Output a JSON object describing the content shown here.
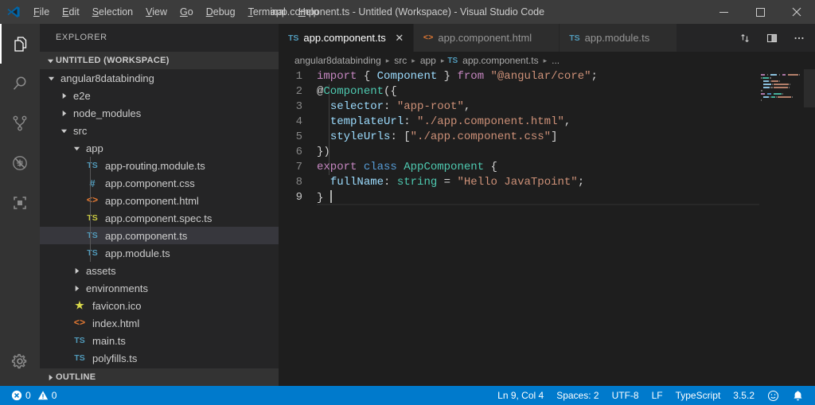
{
  "titlebar": {
    "window_title": "app.component.ts - Untitled (Workspace) - Visual Studio Code",
    "logo_icon": "vscode-logo-icon",
    "menus": [
      {
        "label": "File",
        "icon": "menu-file"
      },
      {
        "label": "Edit",
        "icon": "menu-edit"
      },
      {
        "label": "Selection",
        "icon": "menu-selection"
      },
      {
        "label": "View",
        "icon": "menu-view"
      },
      {
        "label": "Go",
        "icon": "menu-go"
      },
      {
        "label": "Debug",
        "icon": "menu-debug"
      },
      {
        "label": "Terminal",
        "icon": "menu-terminal"
      },
      {
        "label": "Help",
        "icon": "menu-help"
      }
    ],
    "controls": {
      "minimize": "minimize-icon",
      "maximize": "maximize-icon",
      "close": "close-icon"
    }
  },
  "activitybar": {
    "items": [
      {
        "name": "explorer",
        "icon": "files-icon",
        "active": true
      },
      {
        "name": "search",
        "icon": "search-icon",
        "active": false
      },
      {
        "name": "source-control",
        "icon": "source-control-icon",
        "active": false
      },
      {
        "name": "debug",
        "icon": "debug-icon",
        "active": false
      },
      {
        "name": "extensions",
        "icon": "extensions-icon",
        "active": false
      }
    ],
    "bottom": [
      {
        "name": "manage",
        "icon": "gear-icon"
      }
    ]
  },
  "sidebar": {
    "title": "EXPLORER",
    "workspace_header": "UNTITLED (WORKSPACE)",
    "outline_header": "OUTLINE",
    "tree": [
      {
        "label": "angular8databinding",
        "indent": 1,
        "kind": "folder",
        "expanded": true,
        "icon": "chevron-down-icon",
        "selected": false
      },
      {
        "label": "e2e",
        "indent": 2,
        "kind": "folder",
        "expanded": false,
        "icon": "chevron-right-icon",
        "selected": false
      },
      {
        "label": "node_modules",
        "indent": 2,
        "kind": "folder",
        "expanded": false,
        "icon": "chevron-right-icon",
        "selected": false
      },
      {
        "label": "src",
        "indent": 2,
        "kind": "folder",
        "expanded": true,
        "icon": "chevron-down-icon",
        "selected": false
      },
      {
        "label": "app",
        "indent": 3,
        "kind": "folder",
        "expanded": true,
        "icon": "chevron-down-icon",
        "selected": false
      },
      {
        "label": "app-routing.module.ts",
        "indent": 4,
        "kind": "file",
        "icon": "ts-file-icon",
        "badge": "TS",
        "selected": false
      },
      {
        "label": "app.component.css",
        "indent": 4,
        "kind": "file",
        "icon": "css-file-icon",
        "badge": "#",
        "selected": false
      },
      {
        "label": "app.component.html",
        "indent": 4,
        "kind": "file",
        "icon": "html-file-icon",
        "badge": "<>",
        "selected": false
      },
      {
        "label": "app.component.spec.ts",
        "indent": 4,
        "kind": "file",
        "icon": "spec-file-icon",
        "badge": "TS",
        "selected": false
      },
      {
        "label": "app.component.ts",
        "indent": 4,
        "kind": "file",
        "icon": "ts-file-icon",
        "badge": "TS",
        "selected": true
      },
      {
        "label": "app.module.ts",
        "indent": 4,
        "kind": "file",
        "icon": "ts-file-icon",
        "badge": "TS",
        "selected": false
      },
      {
        "label": "assets",
        "indent": 3,
        "kind": "folder",
        "expanded": false,
        "icon": "chevron-right-icon",
        "selected": false
      },
      {
        "label": "environments",
        "indent": 3,
        "kind": "folder",
        "expanded": false,
        "icon": "chevron-right-icon",
        "selected": false
      },
      {
        "label": "favicon.ico",
        "indent": 3,
        "kind": "file",
        "icon": "star-file-icon",
        "badge": "★",
        "selected": false
      },
      {
        "label": "index.html",
        "indent": 3,
        "kind": "file",
        "icon": "html-file-icon",
        "badge": "<>",
        "selected": false
      },
      {
        "label": "main.ts",
        "indent": 3,
        "kind": "file",
        "icon": "ts-file-icon",
        "badge": "TS",
        "selected": false
      },
      {
        "label": "polyfills.ts",
        "indent": 3,
        "kind": "file",
        "icon": "ts-file-icon",
        "badge": "TS",
        "selected": false
      }
    ]
  },
  "editor": {
    "tabs": [
      {
        "label": "app.component.ts",
        "badge": "TS",
        "icon": "ts-file-icon",
        "active": true,
        "close_icon": "close-icon"
      },
      {
        "label": "app.component.html",
        "badge": "<>",
        "icon": "html-file-icon",
        "active": false,
        "close_icon": "close-icon"
      },
      {
        "label": "app.module.ts",
        "badge": "TS",
        "icon": "ts-file-icon",
        "active": false,
        "close_icon": "close-icon"
      }
    ],
    "actions": [
      {
        "name": "split-editor-vertical",
        "icon": "split-editor-icon"
      },
      {
        "name": "toggle-panel",
        "icon": "layout-panel-icon"
      },
      {
        "name": "more-actions",
        "icon": "ellipsis-icon"
      }
    ],
    "breadcrumb": [
      {
        "label": "angular8databinding",
        "badge": ""
      },
      {
        "label": "src",
        "badge": ""
      },
      {
        "label": "app",
        "badge": ""
      },
      {
        "label": "app.component.ts",
        "badge": "TS"
      },
      {
        "label": "...",
        "badge": ""
      }
    ],
    "breadcrumb_separator": "▸",
    "line_numbers": [
      "1",
      "2",
      "3",
      "4",
      "5",
      "6",
      "7",
      "8",
      "9"
    ],
    "current_line": 9,
    "code_lines": [
      [
        {
          "t": "import",
          "c": "t-kw"
        },
        {
          "t": " ",
          "c": "t-punc"
        },
        {
          "t": "{",
          "c": "t-punc"
        },
        {
          "t": " ",
          "c": "t-punc"
        },
        {
          "t": "Component",
          "c": "t-var"
        },
        {
          "t": " ",
          "c": "t-punc"
        },
        {
          "t": "}",
          "c": "t-punc"
        },
        {
          "t": " ",
          "c": "t-punc"
        },
        {
          "t": "from",
          "c": "t-kw"
        },
        {
          "t": " ",
          "c": "t-punc"
        },
        {
          "t": "\"@angular/core\"",
          "c": "t-str"
        },
        {
          "t": ";",
          "c": "t-punc"
        }
      ],
      [
        {
          "t": "@",
          "c": "t-dec"
        },
        {
          "t": "Component",
          "c": "t-type"
        },
        {
          "t": "({",
          "c": "t-punc"
        }
      ],
      [
        {
          "t": "  ",
          "c": "t-punc"
        },
        {
          "t": "selector",
          "c": "t-var"
        },
        {
          "t": ": ",
          "c": "t-punc"
        },
        {
          "t": "\"app-root\"",
          "c": "t-str"
        },
        {
          "t": ",",
          "c": "t-punc"
        }
      ],
      [
        {
          "t": "  ",
          "c": "t-punc"
        },
        {
          "t": "templateUrl",
          "c": "t-var"
        },
        {
          "t": ": ",
          "c": "t-punc"
        },
        {
          "t": "\"./app.component.html\"",
          "c": "t-str"
        },
        {
          "t": ",",
          "c": "t-punc"
        }
      ],
      [
        {
          "t": "  ",
          "c": "t-punc"
        },
        {
          "t": "styleUrls",
          "c": "t-var"
        },
        {
          "t": ": [",
          "c": "t-punc"
        },
        {
          "t": "\"./app.component.css\"",
          "c": "t-str"
        },
        {
          "t": "]",
          "c": "t-punc"
        }
      ],
      [
        {
          "t": "})",
          "c": "t-punc"
        }
      ],
      [
        {
          "t": "export",
          "c": "t-kw"
        },
        {
          "t": " ",
          "c": "t-punc"
        },
        {
          "t": "class",
          "c": "t-ctl"
        },
        {
          "t": " ",
          "c": "t-punc"
        },
        {
          "t": "AppComponent",
          "c": "t-type"
        },
        {
          "t": " {",
          "c": "t-punc"
        }
      ],
      [
        {
          "t": "  ",
          "c": "t-punc"
        },
        {
          "t": "fullName",
          "c": "t-var"
        },
        {
          "t": ": ",
          "c": "t-punc"
        },
        {
          "t": "string",
          "c": "t-type"
        },
        {
          "t": " = ",
          "c": "t-punc"
        },
        {
          "t": "\"Hello JavaTpoint\"",
          "c": "t-str"
        },
        {
          "t": ";",
          "c": "t-punc"
        }
      ],
      [
        {
          "t": "}",
          "c": "t-punc"
        },
        {
          "t": " ",
          "c": "t-punc"
        }
      ]
    ]
  },
  "statusbar": {
    "errors": "0",
    "warnings": "0",
    "error_icon": "error-circle-icon",
    "warning_icon": "warning-triangle-icon",
    "cursor_position": "Ln 9, Col 4",
    "indentation": "Spaces: 2",
    "encoding": "UTF-8",
    "eol": "LF",
    "language": "TypeScript",
    "version": "3.5.2",
    "feedback_icon": "smiley-icon",
    "notifications_icon": "bell-icon"
  },
  "colors": {
    "accent": "#007acc",
    "titlebar_bg": "#3c3c3c",
    "activitybar_bg": "#333333",
    "sidebar_bg": "#252526",
    "editor_bg": "#1e1e1e",
    "selection_bg": "#37373d"
  }
}
